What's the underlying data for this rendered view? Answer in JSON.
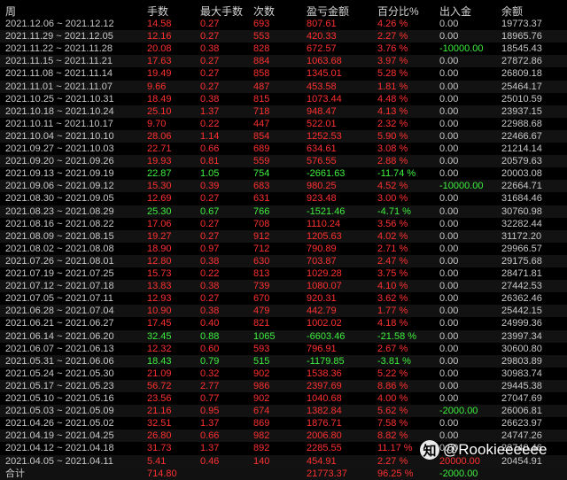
{
  "headers": [
    "周",
    "手数",
    "最大手数",
    "次数",
    "盈亏金额",
    "百分比%",
    "出入金",
    "余额"
  ],
  "rows": [
    {
      "week": "2021.12.06 ~ 2021.12.12",
      "lots": "14.58",
      "maxlots": "0.27",
      "count": "693",
      "pnl": "807.61",
      "pct": "4.26 %",
      "flow": "0.00",
      "balance": "19773.37",
      "sign": "pos"
    },
    {
      "week": "2021.11.29 ~ 2021.12.05",
      "lots": "12.16",
      "maxlots": "0.27",
      "count": "553",
      "pnl": "420.33",
      "pct": "2.27 %",
      "flow": "0.00",
      "balance": "18965.76",
      "sign": "pos"
    },
    {
      "week": "2021.11.22 ~ 2021.11.28",
      "lots": "20.08",
      "maxlots": "0.38",
      "count": "828",
      "pnl": "672.57",
      "pct": "3.76 %",
      "flow": "-10000.00",
      "balance": "18545.43",
      "sign": "pos",
      "flow_neg": true
    },
    {
      "week": "2021.11.15 ~ 2021.11.21",
      "lots": "17.63",
      "maxlots": "0.27",
      "count": "884",
      "pnl": "1063.68",
      "pct": "3.97 %",
      "flow": "0.00",
      "balance": "27872.86",
      "sign": "pos"
    },
    {
      "week": "2021.11.08 ~ 2021.11.14",
      "lots": "19.49",
      "maxlots": "0.27",
      "count": "858",
      "pnl": "1345.01",
      "pct": "5.28 %",
      "flow": "0.00",
      "balance": "26809.18",
      "sign": "pos"
    },
    {
      "week": "2021.11.01 ~ 2021.11.07",
      "lots": "9.66",
      "maxlots": "0.27",
      "count": "487",
      "pnl": "453.58",
      "pct": "1.81 %",
      "flow": "0.00",
      "balance": "25464.17",
      "sign": "pos"
    },
    {
      "week": "2021.10.25 ~ 2021.10.31",
      "lots": "18.49",
      "maxlots": "0.38",
      "count": "815",
      "pnl": "1073.44",
      "pct": "4.48 %",
      "flow": "0.00",
      "balance": "25010.59",
      "sign": "pos"
    },
    {
      "week": "2021.10.18 ~ 2021.10.24",
      "lots": "25.10",
      "maxlots": "1.37",
      "count": "718",
      "pnl": "948.47",
      "pct": "4.13 %",
      "flow": "0.00",
      "balance": "23937.15",
      "sign": "pos"
    },
    {
      "week": "2021.10.11 ~ 2021.10.17",
      "lots": "9.70",
      "maxlots": "0.22",
      "count": "447",
      "pnl": "522.01",
      "pct": "2.32 %",
      "flow": "0.00",
      "balance": "22988.68",
      "sign": "pos"
    },
    {
      "week": "2021.10.04 ~ 2021.10.10",
      "lots": "28.06",
      "maxlots": "1.14",
      "count": "854",
      "pnl": "1252.53",
      "pct": "5.90 %",
      "flow": "0.00",
      "balance": "22466.67",
      "sign": "pos"
    },
    {
      "week": "2021.09.27 ~ 2021.10.03",
      "lots": "22.71",
      "maxlots": "0.66",
      "count": "689",
      "pnl": "634.61",
      "pct": "3.08 %",
      "flow": "0.00",
      "balance": "21214.14",
      "sign": "pos"
    },
    {
      "week": "2021.09.20 ~ 2021.09.26",
      "lots": "19.93",
      "maxlots": "0.81",
      "count": "559",
      "pnl": "576.55",
      "pct": "2.88 %",
      "flow": "0.00",
      "balance": "20579.63",
      "sign": "pos"
    },
    {
      "week": "2021.09.13 ~ 2021.09.19",
      "lots": "22.87",
      "maxlots": "1.05",
      "count": "754",
      "pnl": "-2661.63",
      "pct": "-11.74 %",
      "flow": "0.00",
      "balance": "20003.08",
      "sign": "neg"
    },
    {
      "week": "2021.09.06 ~ 2021.09.12",
      "lots": "15.30",
      "maxlots": "0.39",
      "count": "683",
      "pnl": "980.25",
      "pct": "4.52 %",
      "flow": "-10000.00",
      "balance": "22664.71",
      "sign": "pos",
      "flow_neg": true
    },
    {
      "week": "2021.08.30 ~ 2021.09.05",
      "lots": "12.69",
      "maxlots": "0.27",
      "count": "631",
      "pnl": "923.48",
      "pct": "3.00 %",
      "flow": "0.00",
      "balance": "31684.46",
      "sign": "pos"
    },
    {
      "week": "2021.08.23 ~ 2021.08.29",
      "lots": "25.30",
      "maxlots": "0.67",
      "count": "766",
      "pnl": "-1521.46",
      "pct": "-4.71 %",
      "flow": "0.00",
      "balance": "30760.98",
      "sign": "neg"
    },
    {
      "week": "2021.08.16 ~ 2021.08.22",
      "lots": "17.06",
      "maxlots": "0.27",
      "count": "708",
      "pnl": "1110.24",
      "pct": "3.56 %",
      "flow": "0.00",
      "balance": "32282.44",
      "sign": "pos"
    },
    {
      "week": "2021.08.09 ~ 2021.08.15",
      "lots": "19.27",
      "maxlots": "0.27",
      "count": "912",
      "pnl": "1205.63",
      "pct": "4.02 %",
      "flow": "0.00",
      "balance": "31172.20",
      "sign": "pos"
    },
    {
      "week": "2021.08.02 ~ 2021.08.08",
      "lots": "18.90",
      "maxlots": "0.97",
      "count": "712",
      "pnl": "790.89",
      "pct": "2.71 %",
      "flow": "0.00",
      "balance": "29966.57",
      "sign": "pos"
    },
    {
      "week": "2021.07.26 ~ 2021.08.01",
      "lots": "12.80",
      "maxlots": "0.38",
      "count": "630",
      "pnl": "703.87",
      "pct": "2.47 %",
      "flow": "0.00",
      "balance": "29175.68",
      "sign": "pos"
    },
    {
      "week": "2021.07.19 ~ 2021.07.25",
      "lots": "15.73",
      "maxlots": "0.22",
      "count": "813",
      "pnl": "1029.28",
      "pct": "3.75 %",
      "flow": "0.00",
      "balance": "28471.81",
      "sign": "pos"
    },
    {
      "week": "2021.07.12 ~ 2021.07.18",
      "lots": "13.83",
      "maxlots": "0.38",
      "count": "739",
      "pnl": "1080.07",
      "pct": "4.10 %",
      "flow": "0.00",
      "balance": "27442.53",
      "sign": "pos"
    },
    {
      "week": "2021.07.05 ~ 2021.07.11",
      "lots": "12.93",
      "maxlots": "0.27",
      "count": "670",
      "pnl": "920.31",
      "pct": "3.62 %",
      "flow": "0.00",
      "balance": "26362.46",
      "sign": "pos"
    },
    {
      "week": "2021.06.28 ~ 2021.07.04",
      "lots": "10.90",
      "maxlots": "0.38",
      "count": "479",
      "pnl": "442.79",
      "pct": "1.77 %",
      "flow": "0.00",
      "balance": "25442.15",
      "sign": "pos"
    },
    {
      "week": "2021.06.21 ~ 2021.06.27",
      "lots": "17.45",
      "maxlots": "0.40",
      "count": "821",
      "pnl": "1002.02",
      "pct": "4.18 %",
      "flow": "0.00",
      "balance": "24999.36",
      "sign": "pos"
    },
    {
      "week": "2021.06.14 ~ 2021.06.20",
      "lots": "32.45",
      "maxlots": "0.88",
      "count": "1065",
      "pnl": "-6603.46",
      "pct": "-21.58 %",
      "flow": "0.00",
      "balance": "23997.34",
      "sign": "neg"
    },
    {
      "week": "2021.06.07 ~ 2021.06.13",
      "lots": "12.32",
      "maxlots": "0.60",
      "count": "593",
      "pnl": "796.91",
      "pct": "2.67 %",
      "flow": "0.00",
      "balance": "30600.80",
      "sign": "pos"
    },
    {
      "week": "2021.05.31 ~ 2021.06.06",
      "lots": "18.43",
      "maxlots": "0.79",
      "count": "515",
      "pnl": "-1179.85",
      "pct": "-3.81 %",
      "flow": "0.00",
      "balance": "29803.89",
      "sign": "neg"
    },
    {
      "week": "2021.05.24 ~ 2021.05.30",
      "lots": "21.09",
      "maxlots": "0.32",
      "count": "902",
      "pnl": "1538.36",
      "pct": "5.22 %",
      "flow": "0.00",
      "balance": "30983.74",
      "sign": "pos"
    },
    {
      "week": "2021.05.17 ~ 2021.05.23",
      "lots": "56.72",
      "maxlots": "2.77",
      "count": "986",
      "pnl": "2397.69",
      "pct": "8.86 %",
      "flow": "0.00",
      "balance": "29445.38",
      "sign": "pos"
    },
    {
      "week": "2021.05.10 ~ 2021.05.16",
      "lots": "23.56",
      "maxlots": "0.77",
      "count": "902",
      "pnl": "1040.68",
      "pct": "4.00 %",
      "flow": "0.00",
      "balance": "27047.69",
      "sign": "pos"
    },
    {
      "week": "2021.05.03 ~ 2021.05.09",
      "lots": "21.16",
      "maxlots": "0.95",
      "count": "674",
      "pnl": "1382.84",
      "pct": "5.62 %",
      "flow": "-2000.00",
      "balance": "26006.81",
      "sign": "pos",
      "flow_neg": true
    },
    {
      "week": "2021.04.26 ~ 2021.05.02",
      "lots": "32.51",
      "maxlots": "1.37",
      "count": "869",
      "pnl": "1876.71",
      "pct": "7.58 %",
      "flow": "0.00",
      "balance": "26623.97",
      "sign": "pos"
    },
    {
      "week": "2021.04.19 ~ 2021.04.25",
      "lots": "26.80",
      "maxlots": "0.66",
      "count": "982",
      "pnl": "2006.80",
      "pct": "8.82 %",
      "flow": "0.00",
      "balance": "24747.26",
      "sign": "pos"
    },
    {
      "week": "2021.04.12 ~ 2021.04.18",
      "lots": "31.73",
      "maxlots": "1.37",
      "count": "892",
      "pnl": "2285.55",
      "pct": "11.17 %",
      "flow": "0.00",
      "balance": "22740.46",
      "sign": "pos"
    },
    {
      "week": "2021.04.05 ~ 2021.04.11",
      "lots": "5.41",
      "maxlots": "0.46",
      "count": "140",
      "pnl": "454.91",
      "pct": "2.27 %",
      "flow": "20000.00",
      "balance": "20454.91",
      "sign": "pos",
      "flow_pos": true
    }
  ],
  "footer": {
    "label": "合计",
    "lots": "714.80",
    "pnl": "21773.37",
    "pct": "96.25 %",
    "flow": "-2000.00"
  },
  "watermark": {
    "text": "@Rookieeeeee",
    "logo": "知"
  },
  "colors": {
    "positive": "#ff3030",
    "negative": "#3ef03e",
    "neutral": "#c8c8c8",
    "background": "#000000"
  }
}
